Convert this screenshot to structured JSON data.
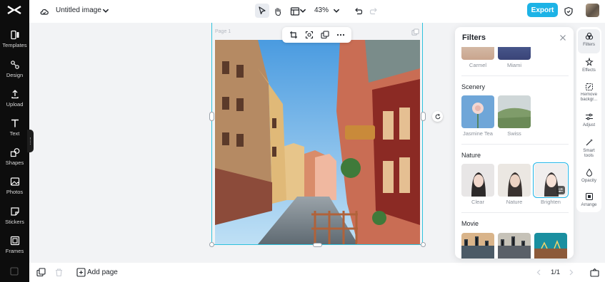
{
  "app": {
    "brand_color": "#1db3e6",
    "sidebar_bg": "#0d0d0d"
  },
  "sidebar": {
    "items": [
      {
        "label": "Templates",
        "icon": "templates-icon"
      },
      {
        "label": "Design",
        "icon": "design-icon"
      },
      {
        "label": "Upload",
        "icon": "upload-icon"
      },
      {
        "label": "Text",
        "icon": "text-icon"
      },
      {
        "label": "Shapes",
        "icon": "shapes-icon"
      },
      {
        "label": "Photos",
        "icon": "photos-icon"
      },
      {
        "label": "Stickers",
        "icon": "stickers-icon"
      },
      {
        "label": "Frames",
        "icon": "frames-icon"
      }
    ]
  },
  "topbar": {
    "title": "Untitled image",
    "zoom": "43%",
    "export_label": "Export"
  },
  "canvas": {
    "page_label": "Page 1"
  },
  "bottombar": {
    "add_page": "Add page",
    "page_count": "1/1"
  },
  "panel": {
    "title": "Filters",
    "top_row": [
      "Carmel",
      "Miami"
    ],
    "sections": [
      {
        "title": "Scenery",
        "items": [
          "Jasmine Tea",
          "Swiss"
        ]
      },
      {
        "title": "Nature",
        "items": [
          "Clear",
          "Nature",
          "Brighten"
        ],
        "selected": "Brighten"
      },
      {
        "title": "Movie"
      }
    ]
  },
  "rail": {
    "items": [
      {
        "label": "Filters",
        "icon": "filters-icon",
        "active": true
      },
      {
        "label": "Effects",
        "icon": "effects-icon"
      },
      {
        "label": "Remove backgr...",
        "label2": "",
        "icon": "remove-background-icon"
      },
      {
        "label": "Adjust",
        "icon": "adjust-icon"
      },
      {
        "label": "Smart tools",
        "icon": "smart-tools-icon"
      },
      {
        "label": "Opacity",
        "icon": "opacity-icon"
      },
      {
        "label": "Arrange",
        "icon": "arrange-icon"
      }
    ]
  }
}
